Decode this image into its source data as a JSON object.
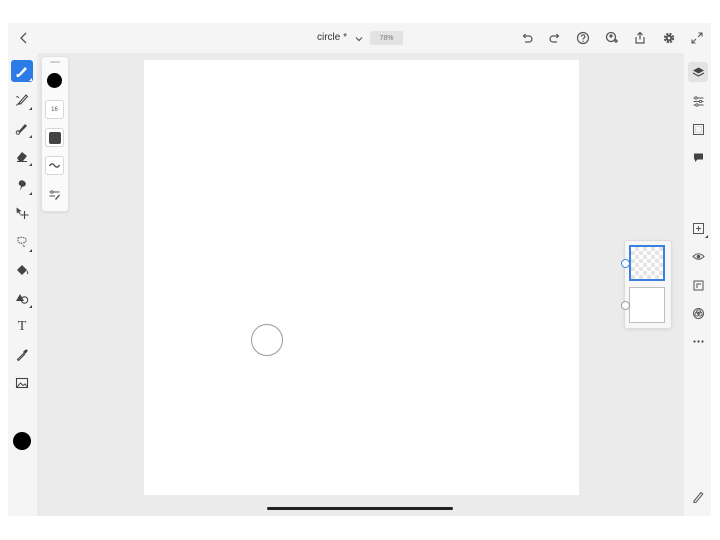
{
  "document": {
    "title": "circle *",
    "zoom": "78%"
  },
  "topbar": {
    "icons": [
      "back-chevron-icon",
      "title-chevron-icon",
      "undo-icon",
      "redo-icon",
      "help-icon",
      "add-user-icon",
      "share-icon",
      "settings-icon",
      "fullscreen-icon"
    ]
  },
  "left_toolbar": {
    "active_tool": "pixel-brush",
    "tools": [
      "pixel-brush",
      "live-brush",
      "vector-brush",
      "eraser",
      "smudge",
      "transform",
      "selection",
      "fill",
      "shapes",
      "text",
      "eyedropper",
      "image"
    ],
    "text_tool_glyph": "T",
    "current_color": "#000000"
  },
  "brush_panel": {
    "color": "#000000",
    "size_label": "16",
    "opacity_preview": "#444444"
  },
  "layers": [
    {
      "kind": "transparent",
      "selected": true
    },
    {
      "kind": "background",
      "selected": false
    }
  ],
  "right_toolbar": {
    "tools": [
      "layers-icon",
      "properties-icon",
      "canvas-grid-icon",
      "comments-icon",
      "add-layer-icon",
      "visibility-icon",
      "layer-actions-icon",
      "mask-icon",
      "more-icon",
      "edit-pencil-icon"
    ],
    "active": "layers-icon"
  },
  "colors": {
    "accent": "#2c7ce8",
    "toolbar_bg": "#f5f5f5",
    "workspace_bg": "#ebebeb",
    "canvas_bg": "#ffffff"
  }
}
